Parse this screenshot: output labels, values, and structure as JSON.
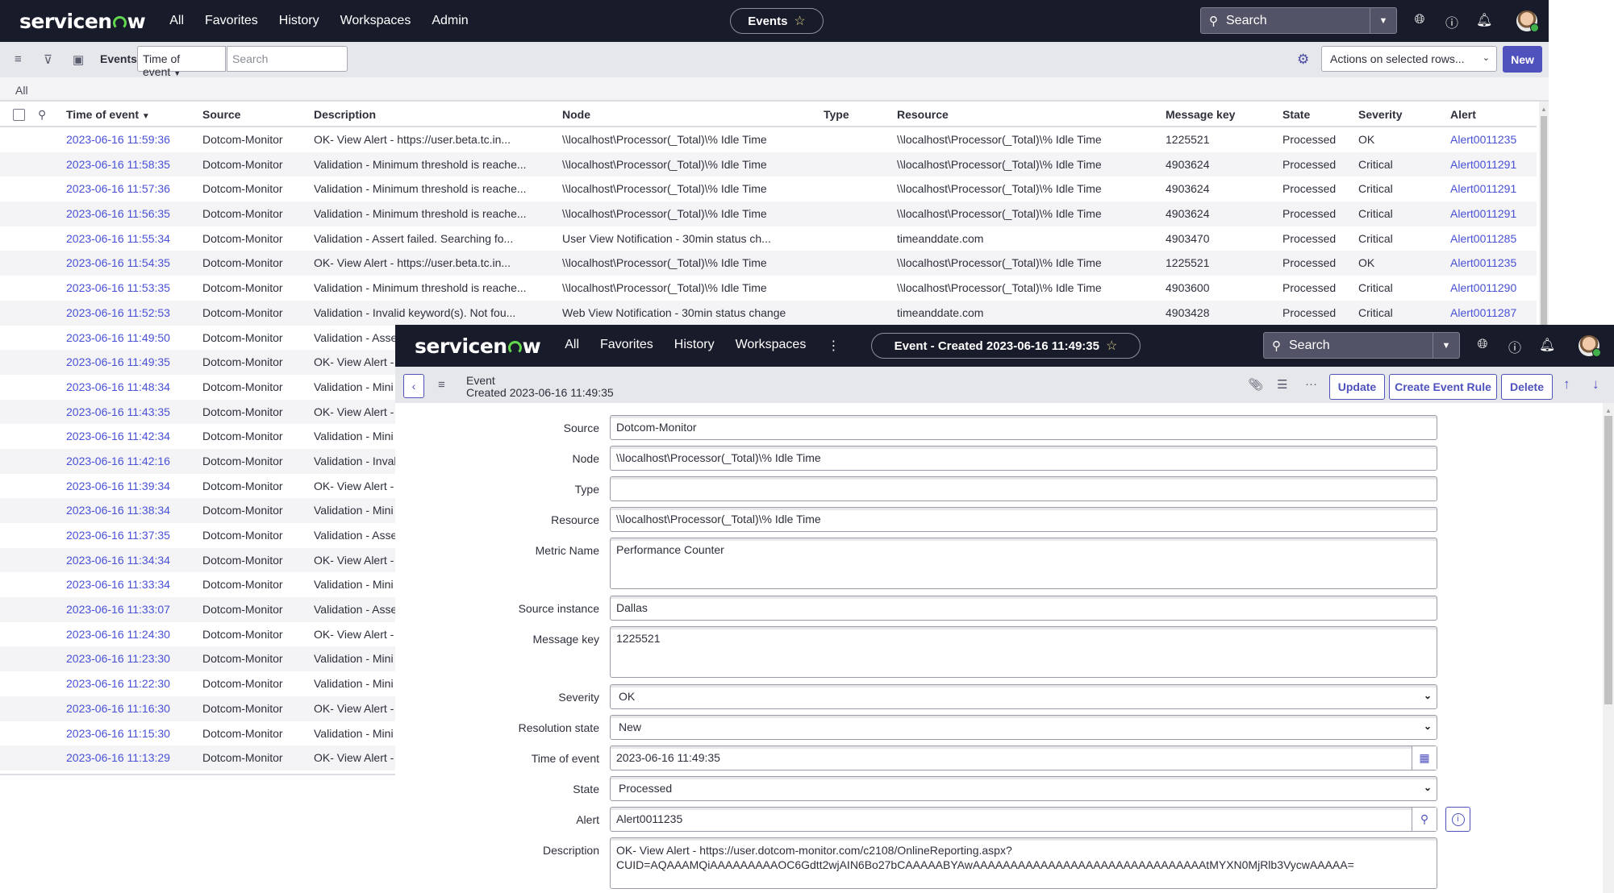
{
  "list_window": {
    "nav": {
      "logo": "servicenow",
      "links": [
        "All",
        "Favorites",
        "History",
        "Workspaces",
        "Admin"
      ],
      "context_pill": "Events",
      "search_label": "Search"
    },
    "toolbar": {
      "title": "Events",
      "field_select": "Time of event",
      "search_placeholder": "Search",
      "actions_select": "Actions on selected rows...",
      "new_label": "New"
    },
    "breadcrumb": "All",
    "columns": [
      "Time of event",
      "Source",
      "Description",
      "Node",
      "Type",
      "Resource",
      "Message key",
      "State",
      "Severity",
      "Alert"
    ],
    "sort_indicator": "▼",
    "rows": [
      {
        "time": "2023-06-16 11:59:36",
        "source": "Dotcom-Monitor",
        "description": "OK- View Alert - https://user.beta.tc.in...",
        "node": "\\\\localhost\\Processor(_Total)\\% Idle Time",
        "type": "",
        "resource": "\\\\localhost\\Processor(_Total)\\% Idle Time",
        "message_key": "1225521",
        "state": "Processed",
        "severity": "OK",
        "alert": "Alert0011235"
      },
      {
        "time": "2023-06-16 11:58:35",
        "source": "Dotcom-Monitor",
        "description": "Validation - Minimum threshold is reache...",
        "node": "\\\\localhost\\Processor(_Total)\\% Idle Time",
        "type": "",
        "resource": "\\\\localhost\\Processor(_Total)\\% Idle Time",
        "message_key": "4903624",
        "state": "Processed",
        "severity": "Critical",
        "alert": "Alert0011291"
      },
      {
        "time": "2023-06-16 11:57:36",
        "source": "Dotcom-Monitor",
        "description": "Validation - Minimum threshold is reache...",
        "node": "\\\\localhost\\Processor(_Total)\\% Idle Time",
        "type": "",
        "resource": "\\\\localhost\\Processor(_Total)\\% Idle Time",
        "message_key": "4903624",
        "state": "Processed",
        "severity": "Critical",
        "alert": "Alert0011291"
      },
      {
        "time": "2023-06-16 11:56:35",
        "source": "Dotcom-Monitor",
        "description": "Validation - Minimum threshold is reache...",
        "node": "\\\\localhost\\Processor(_Total)\\% Idle Time",
        "type": "",
        "resource": "\\\\localhost\\Processor(_Total)\\% Idle Time",
        "message_key": "4903624",
        "state": "Processed",
        "severity": "Critical",
        "alert": "Alert0011291"
      },
      {
        "time": "2023-06-16 11:55:34",
        "source": "Dotcom-Monitor",
        "description": "Validation - Assert failed. Searching fo...",
        "node": "User View Notification - 30min status ch...",
        "type": "",
        "resource": "timeanddate.com",
        "message_key": "4903470",
        "state": "Processed",
        "severity": "Critical",
        "alert": "Alert0011285"
      },
      {
        "time": "2023-06-16 11:54:35",
        "source": "Dotcom-Monitor",
        "description": "OK- View Alert - https://user.beta.tc.in...",
        "node": "\\\\localhost\\Processor(_Total)\\% Idle Time",
        "type": "",
        "resource": "\\\\localhost\\Processor(_Total)\\% Idle Time",
        "message_key": "1225521",
        "state": "Processed",
        "severity": "OK",
        "alert": "Alert0011235"
      },
      {
        "time": "2023-06-16 11:53:35",
        "source": "Dotcom-Monitor",
        "description": "Validation - Minimum threshold is reache...",
        "node": "\\\\localhost\\Processor(_Total)\\% Idle Time",
        "type": "",
        "resource": "\\\\localhost\\Processor(_Total)\\% Idle Time",
        "message_key": "4903600",
        "state": "Processed",
        "severity": "Critical",
        "alert": "Alert0011290"
      },
      {
        "time": "2023-06-16 11:52:53",
        "source": "Dotcom-Monitor",
        "description": "Validation - Invalid keyword(s). Not fou...",
        "node": "Web View Notification - 30min status change",
        "type": "",
        "resource": "timeanddate.com",
        "message_key": "4903428",
        "state": "Processed",
        "severity": "Critical",
        "alert": "Alert0011287"
      },
      {
        "time": "2023-06-16 11:49:50",
        "source": "Dotcom-Monitor",
        "description": "Validation - Asse"
      },
      {
        "time": "2023-06-16 11:49:35",
        "source": "Dotcom-Monitor",
        "description": "OK- View Alert -"
      },
      {
        "time": "2023-06-16 11:48:34",
        "source": "Dotcom-Monitor",
        "description": "Validation - Mini"
      },
      {
        "time": "2023-06-16 11:43:35",
        "source": "Dotcom-Monitor",
        "description": "OK- View Alert -"
      },
      {
        "time": "2023-06-16 11:42:34",
        "source": "Dotcom-Monitor",
        "description": "Validation - Mini"
      },
      {
        "time": "2023-06-16 11:42:16",
        "source": "Dotcom-Monitor",
        "description": "Validation - Inval"
      },
      {
        "time": "2023-06-16 11:39:34",
        "source": "Dotcom-Monitor",
        "description": "OK- View Alert -"
      },
      {
        "time": "2023-06-16 11:38:34",
        "source": "Dotcom-Monitor",
        "description": "Validation - Mini"
      },
      {
        "time": "2023-06-16 11:37:35",
        "source": "Dotcom-Monitor",
        "description": "Validation - Asse"
      },
      {
        "time": "2023-06-16 11:34:34",
        "source": "Dotcom-Monitor",
        "description": "OK- View Alert -"
      },
      {
        "time": "2023-06-16 11:33:34",
        "source": "Dotcom-Monitor",
        "description": "Validation - Mini"
      },
      {
        "time": "2023-06-16 11:33:07",
        "source": "Dotcom-Monitor",
        "description": "Validation - Asse"
      },
      {
        "time": "2023-06-16 11:24:30",
        "source": "Dotcom-Monitor",
        "description": "OK- View Alert -"
      },
      {
        "time": "2023-06-16 11:23:30",
        "source": "Dotcom-Monitor",
        "description": "Validation - Mini"
      },
      {
        "time": "2023-06-16 11:22:30",
        "source": "Dotcom-Monitor",
        "description": "Validation - Mini"
      },
      {
        "time": "2023-06-16 11:16:30",
        "source": "Dotcom-Monitor",
        "description": "OK- View Alert -"
      },
      {
        "time": "2023-06-16 11:15:30",
        "source": "Dotcom-Monitor",
        "description": "Validation - Mini"
      },
      {
        "time": "2023-06-16 11:13:29",
        "source": "Dotcom-Monitor",
        "description": "OK- View Alert -"
      }
    ]
  },
  "form_window": {
    "nav": {
      "logo": "servicenow",
      "links": [
        "All",
        "Favorites",
        "History",
        "Workspaces"
      ],
      "more": "⋮",
      "context_pill": "Event - Created 2023-06-16 11:49:35",
      "search_label": "Search"
    },
    "header": {
      "record_type": "Event",
      "record_subtitle": "Created 2023-06-16 11:49:35",
      "update_label": "Update",
      "create_rule_label": "Create Event Rule",
      "delete_label": "Delete"
    },
    "fields": {
      "source": {
        "label": "Source",
        "value": "Dotcom-Monitor"
      },
      "node": {
        "label": "Node",
        "value": "\\\\localhost\\Processor(_Total)\\% Idle Time"
      },
      "type": {
        "label": "Type",
        "value": ""
      },
      "resource": {
        "label": "Resource",
        "value": "\\\\localhost\\Processor(_Total)\\% Idle Time"
      },
      "metric_name": {
        "label": "Metric Name",
        "value": "Performance Counter"
      },
      "source_instance": {
        "label": "Source instance",
        "value": "Dallas"
      },
      "message_key": {
        "label": "Message key",
        "value": "1225521"
      },
      "severity": {
        "label": "Severity",
        "value": "OK"
      },
      "resolution_state": {
        "label": "Resolution state",
        "value": "New"
      },
      "time_of_event": {
        "label": "Time of event",
        "value": "2023-06-16 11:49:35"
      },
      "state": {
        "label": "State",
        "value": "Processed"
      },
      "alert": {
        "label": "Alert",
        "value": "Alert0011235"
      },
      "description": {
        "label": "Description",
        "value": "OK- View Alert - https://user.dotcom-monitor.com/c2108/OnlineReporting.aspx?\nCUID=AQAAAMQiAAAAAAAAAOC6Gdtt2wjAIN6Bo27bCAAAAABYAwAAAAAAAAAAAAAAAAAAAAAAAAAAAAAAAtMYXN0MjRlb3VycwAAAAA="
      }
    }
  },
  "colors": {
    "nav_bg": "#181b29",
    "accent": "#4f52bd",
    "link": "#4850d6",
    "logo_green": "#62d84e"
  }
}
